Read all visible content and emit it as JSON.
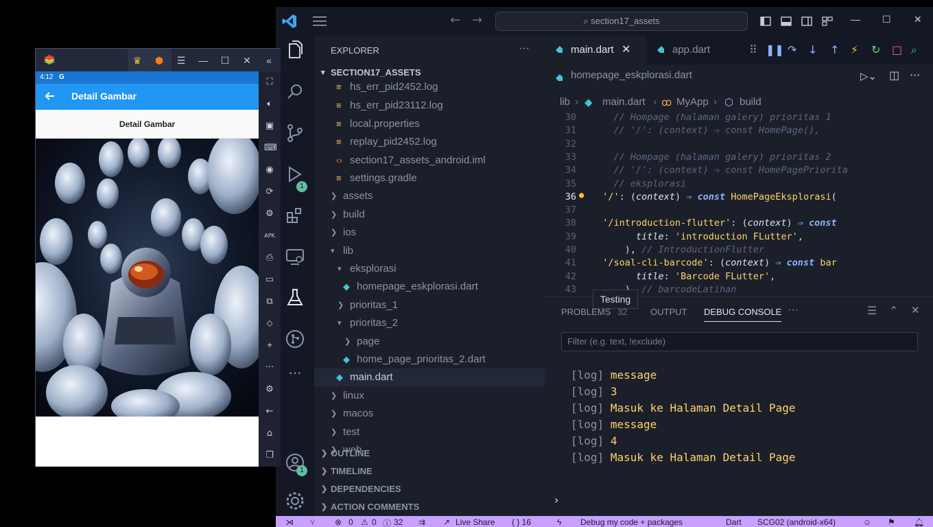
{
  "vscode": {
    "command_center": "section17_assets",
    "window_controls": {
      "minimize": "—",
      "maximize": "☐",
      "close": "✕"
    },
    "activity_badges": {
      "run_debug": "1",
      "accounts": "1"
    },
    "tooltip": "Testing",
    "explorer": {
      "title": "EXPLORER",
      "more": "···",
      "root": "SECTION17_ASSETS",
      "items": [
        {
          "label": "hs_err_pid2452.log",
          "icon": "log-file-icon"
        },
        {
          "label": "hs_err_pid23112.log",
          "icon": "log-file-icon"
        },
        {
          "label": "local.properties",
          "icon": "properties-file-icon"
        },
        {
          "label": "replay_pid2452.log",
          "icon": "log-file-icon"
        },
        {
          "label": "section17_assets_android.iml",
          "icon": "xml-file-icon"
        },
        {
          "label": "settings.gradle",
          "icon": "gradle-file-icon"
        },
        {
          "label": "assets",
          "icon": "folder-chevron-right"
        },
        {
          "label": "build",
          "icon": "folder-chevron-right"
        },
        {
          "label": "ios",
          "icon": "folder-chevron-right"
        },
        {
          "label": "lib",
          "icon": "folder-chevron-down"
        },
        {
          "label": "eksplorasi",
          "icon": "folder-chevron-down"
        },
        {
          "label": "homepage_eskplorasi.dart",
          "icon": "dart-file-icon"
        },
        {
          "label": "prioritas_1",
          "icon": "folder-chevron-right"
        },
        {
          "label": "prioritas_2",
          "icon": "folder-chevron-down"
        },
        {
          "label": "page",
          "icon": "folder-chevron-right"
        },
        {
          "label": "home_page_prioritas_2.dart",
          "icon": "dart-file-icon"
        },
        {
          "label": "main.dart",
          "icon": "dart-file-icon"
        },
        {
          "label": "linux",
          "icon": "folder-chevron-right"
        },
        {
          "label": "macos",
          "icon": "folder-chevron-right"
        },
        {
          "label": "test",
          "icon": "folder-chevron-right"
        },
        {
          "label": "web",
          "icon": "folder-chevron-right"
        }
      ],
      "sections": [
        "OUTLINE",
        "TIMELINE",
        "DEPENDENCIES",
        "ACTION COMMENTS"
      ]
    },
    "tabs": [
      {
        "label": "main.dart",
        "active": true
      },
      {
        "label": "app.dart",
        "active": false
      }
    ],
    "open_file": "homepage_eskplorasi.dart",
    "breadcrumb": [
      "lib",
      "main.dart",
      "MyApp",
      "build"
    ],
    "code_lines": [
      {
        "n": "30",
        "t": "    // Hompage (halaman galery) prioritas 1"
      },
      {
        "n": "31",
        "t": "    // '/': (context) ⇒ const HomePage(),"
      },
      {
        "n": "32",
        "t": ""
      },
      {
        "n": "33",
        "t": "    // Hompage (halaman galery) prioritas 2"
      },
      {
        "n": "34",
        "t": "    // '/': (context) ⇒ const HomePagePriorita"
      },
      {
        "n": "35",
        "t": "    // eksplorasi"
      },
      {
        "n": "36",
        "t": "  '/': (context) ⇒ const HomePageEksplorasi("
      },
      {
        "n": "37",
        "t": ""
      },
      {
        "n": "38",
        "t": "  '/introduction-flutter': (context) ⇒ const"
      },
      {
        "n": "39",
        "t": "        title: 'introduction FLutter',"
      },
      {
        "n": "40",
        "t": "      ), // IntroductionFlutter"
      },
      {
        "n": "41",
        "t": "  '/soal-cli-barcode': (context) ⇒ const bar"
      },
      {
        "n": "42",
        "t": "        title: 'Barcode FLutter',"
      },
      {
        "n": "43",
        "t": "      ), // barcodeLatihan"
      }
    ],
    "panel": {
      "tabs": [
        "PROBLEMS",
        "OUTPUT",
        "DEBUG CONSOLE"
      ],
      "problems_count": "32",
      "filter_placeholder": "Filter (e.g. text, !exclude)",
      "logs": [
        {
          "tag": "[log]",
          "msg": "message"
        },
        {
          "tag": "[log]",
          "msg": "3"
        },
        {
          "tag": "[log]",
          "msg": "Masuk ke Halaman Detail Page"
        },
        {
          "tag": "[log]",
          "msg": "message"
        },
        {
          "tag": "[log]",
          "msg": "4"
        },
        {
          "tag": "[log]",
          "msg": "Masuk ke Halaman Detail Page"
        }
      ],
      "prompt": "›"
    },
    "status_bar": {
      "errors": "0",
      "warnings": "0",
      "infos": "32",
      "live_share": "Live Share",
      "braces": "{ } 16",
      "debug": "Debug my code + packages",
      "language": "Dart",
      "device": "SCG02 (android-x64)"
    },
    "colors": {
      "accent": "#c8a0ff",
      "bg": "#1b1f2a",
      "string": "#ffd36b"
    }
  },
  "emulator": {
    "time": "4:12",
    "status_icon": "G",
    "appbar_title": "Detail Gambar",
    "subheader": "Detail Gambar",
    "image_subject": "astronaut-among-masks-photo",
    "colors": {
      "appbar": "#2196f3",
      "statusbar": "#1976d2"
    }
  }
}
